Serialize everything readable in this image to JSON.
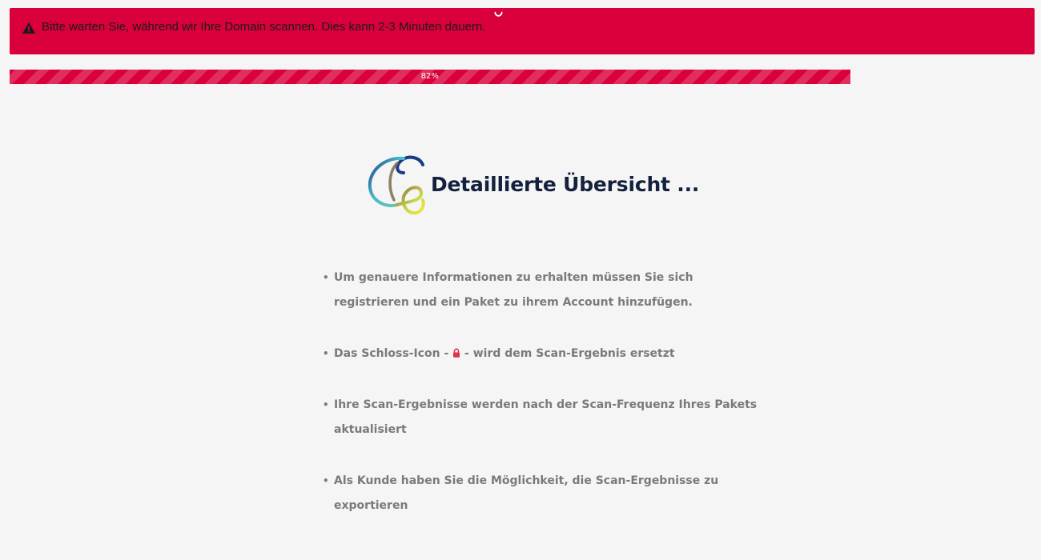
{
  "alert": {
    "icon": "warning-triangle-icon",
    "message": "Bitte warten Sie, während wir Ihre Domain scannen. Dies kann 2-3 Minuten dauern.",
    "color": "#d9003b"
  },
  "progress": {
    "value": 0.82,
    "label": "82%",
    "color": "#d9003b"
  },
  "hero": {
    "logo": "ring-logo-icon",
    "title": "Detaillierte Übersicht ..."
  },
  "info": {
    "items": [
      {
        "text": "Um genauere Informationen zu erhalten müssen Sie sich registrieren und ein Paket zu ihrem Account hinzufügen."
      },
      {
        "before": "Das Schloss-Icon -",
        "icon": "lock-icon",
        "after": "- wird dem Scan-Ergebnis ersetzt"
      },
      {
        "text": "Ihre Scan-Ergebnisse werden nach der Scan-Frequenz Ihres Pakets aktualisiert"
      },
      {
        "text": "Als Kunde haben Sie die Möglichkeit, die Scan-Ergebnisse zu exportieren"
      }
    ]
  }
}
